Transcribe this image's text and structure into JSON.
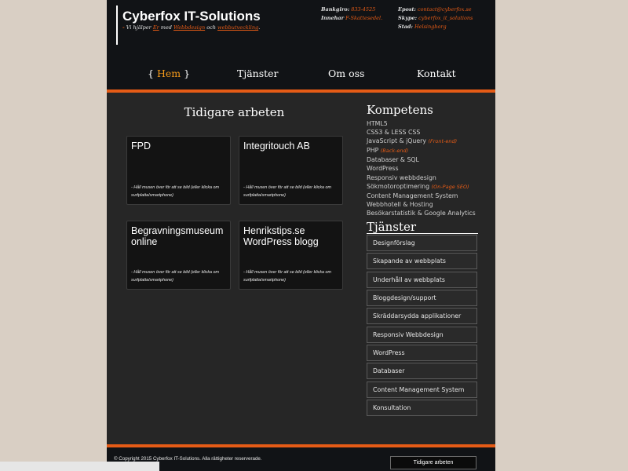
{
  "brand": {
    "title": "Cyberfox IT-Solutions",
    "tagline_dash": "-",
    "tagline_prefix": "Vi hjälper",
    "tagline_er": "Er",
    "tagline_med": "med",
    "tagline_link1": "Webbdesign",
    "tagline_och": "och",
    "tagline_link2": "webbutveckling"
  },
  "info": {
    "bankgiro_label": "Bankgiro:",
    "bankgiro_value": "833-4525",
    "fskatt_label": "Innehar",
    "fskatt_value": "F-Skattesedel.",
    "email_label": "Epost:",
    "email_value": "contact@cyberfox.se",
    "skype_label": "Skype:",
    "skype_value": "cyberfox_it_solutions",
    "city_label": "Stad:",
    "city_value": "Helsingborg"
  },
  "nav": {
    "brace_open": "{",
    "brace_close": "}",
    "items": [
      "Hem",
      "Tjänster",
      "Om oss",
      "Kontakt"
    ]
  },
  "main": {
    "title": "Tidigare arbeten",
    "works": [
      {
        "title": "FPD",
        "hint": "- Håll musen över för att se bild (eller klicka om surfplatta/smartphone)"
      },
      {
        "title": "Integritouch AB",
        "hint": "- Håll musen över för att se bild (eller klicka om surfplatta/smartphone)"
      },
      {
        "title": "Begravningsmuseum online",
        "hint": "- Håll musen över för att se bild (eller klicka om surfplatta/smartphone)"
      },
      {
        "title": "Henrikstips.se WordPress blogg",
        "hint": "- Håll musen över för att se bild (eller klicka om surfplatta/smartphone)"
      }
    ]
  },
  "sidebar": {
    "competence_title": "Kompetens",
    "competence": [
      {
        "text": "HTML5",
        "note": ""
      },
      {
        "text": "CSS3 & LESS CSS",
        "note": ""
      },
      {
        "text": "JavaScript & jQuery",
        "note": "(Front-end)"
      },
      {
        "text": "PHP",
        "note": "(Back-end)"
      },
      {
        "text": "Databaser & SQL",
        "note": ""
      },
      {
        "text": "WordPress",
        "note": ""
      },
      {
        "text": "Responsiv webbdesign",
        "note": ""
      },
      {
        "text": "Sökmotoroptimering",
        "note": "(On-Page SEO)"
      },
      {
        "text": "Content Management System",
        "note": ""
      },
      {
        "text": "Webbhotell & Hosting",
        "note": ""
      },
      {
        "text": "Besökarstatistik & Google Analytics",
        "note": ""
      }
    ],
    "services_title": "Tjänster",
    "services": [
      "Designförslag",
      "Skapande av webbplats",
      "Underhåll av webbplats",
      "Bloggdesign/support",
      "Skräddarsydda applikationer",
      "Responsiv Webbdesign",
      "WordPress",
      "Databaser",
      "Content Management System",
      "Konsultation"
    ]
  },
  "footer": {
    "copyright": "© Copyright 2015 Cyberfox IT-Solutions. Alla rättigheter reserverade.",
    "button": "Tidigare arbeten"
  },
  "colors": {
    "accent": "#e55b16",
    "active_nav": "#f59a1a",
    "header_bg": "#111316",
    "content_bg": "#262626",
    "page_bg": "#d9cfc4"
  }
}
